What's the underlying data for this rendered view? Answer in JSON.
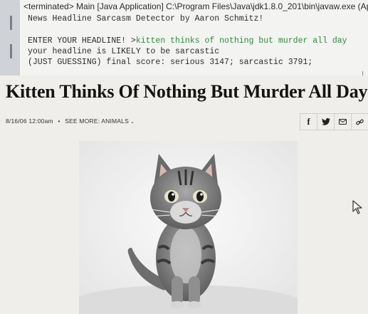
{
  "console": {
    "title": "<terminated> Main [Java Application] C:\\Program Files\\Java\\jdk1.8.0_201\\bin\\javaw.exe (Ap",
    "lines": {
      "program_name": "News Headline Sarcasm Detector by Aaron Schmitz!",
      "prompt": "ENTER YOUR HEADLINE! >",
      "user_input": "kitten thinks of nothing but murder all day",
      "verdict": "your headline is LIKELY to be sarcastic",
      "score": "(JUST GUESSING) final score: serious 3147; sarcastic 3791;"
    }
  },
  "article": {
    "headline": "Kitten Thinks Of Nothing But Murder All Day",
    "date": "8/16/06 12:00am",
    "separator": "•",
    "see_more": "SEE MORE: ANIMALS",
    "share_buttons": [
      {
        "icon": "facebook-icon",
        "glyph": "f"
      },
      {
        "icon": "twitter-icon",
        "glyph": "🐦"
      },
      {
        "icon": "email-icon",
        "glyph": "✉"
      },
      {
        "icon": "link-icon",
        "glyph": "🔗"
      }
    ]
  },
  "colors": {
    "console_bg": "#f3f3f1",
    "input_green": "#2f8a3c",
    "page_bg": "#efeeeb",
    "headline": "#141414"
  }
}
